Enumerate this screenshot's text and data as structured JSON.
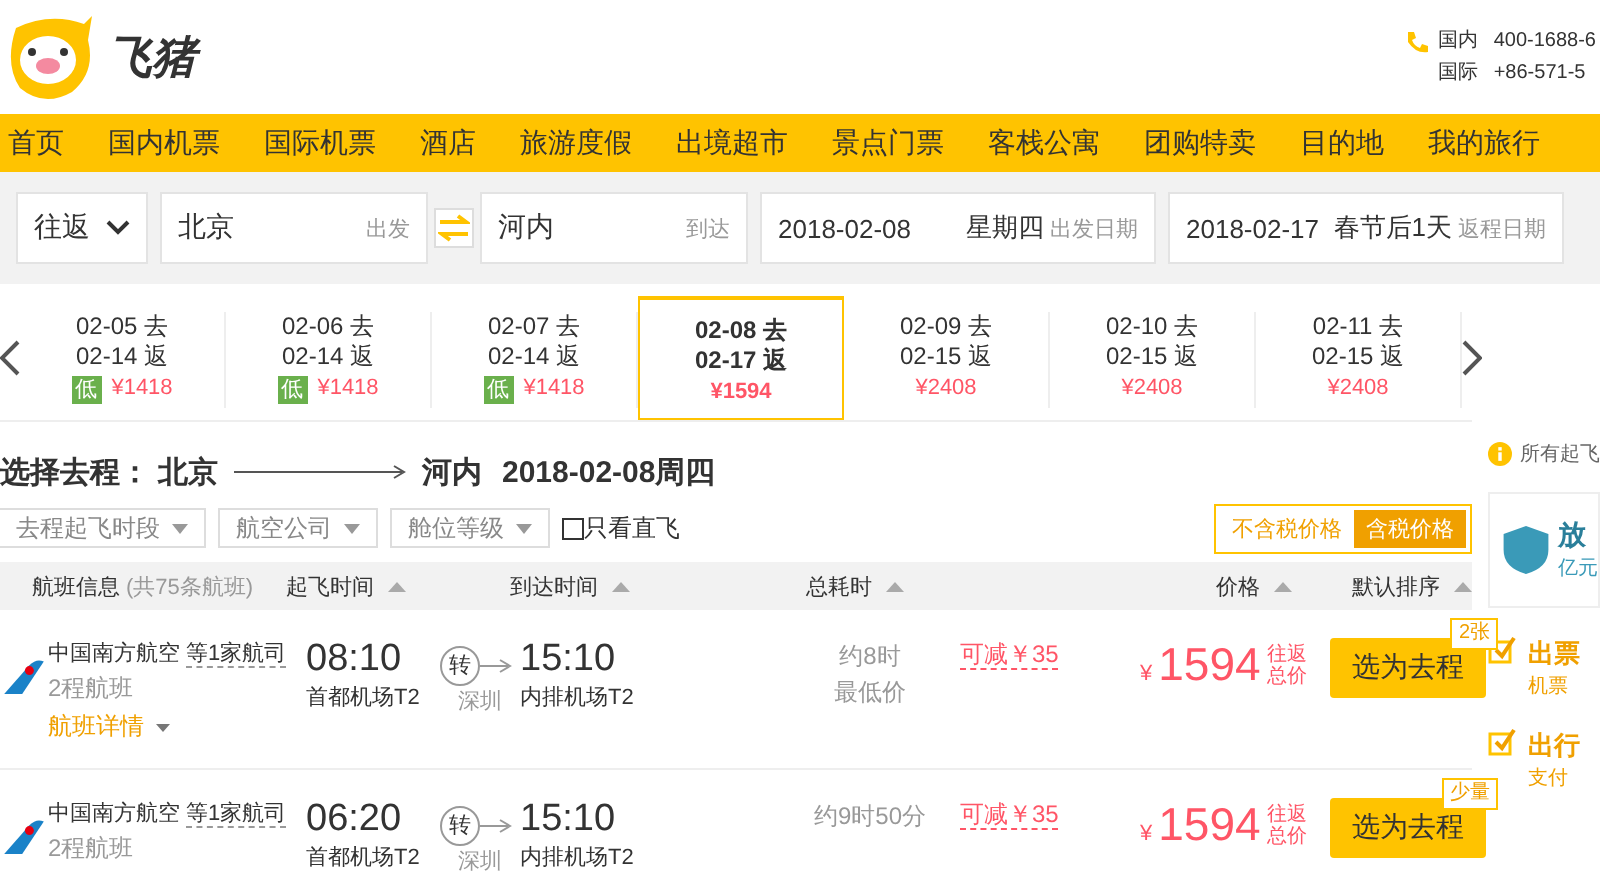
{
  "header": {
    "logo_text": "飞猪",
    "contacts": [
      {
        "label": "国内",
        "number": "400-1688-6"
      },
      {
        "label": "国际",
        "number": "+86-571-5"
      }
    ]
  },
  "nav": [
    "首页",
    "国内机票",
    "国际机票",
    "酒店",
    "旅游度假",
    "出境超市",
    "景点门票",
    "客栈公寓",
    "团购特卖",
    "目的地",
    "我的旅行"
  ],
  "search": {
    "trip_type": "往返",
    "from": {
      "value": "北京",
      "hint": "出发"
    },
    "to": {
      "value": "河内",
      "hint": "到达"
    },
    "depart": {
      "date": "2018-02-08",
      "weekday": "星期四",
      "hint": "出发日期"
    },
    "return": {
      "date": "2018-02-17",
      "weekday": "春节后1天",
      "hint": "返程日期"
    }
  },
  "date_strip": [
    {
      "depart": "02-05 去",
      "return": "02-14 返",
      "badge": "低",
      "price": "¥1418",
      "selected": false
    },
    {
      "depart": "02-06 去",
      "return": "02-14 返",
      "badge": "低",
      "price": "¥1418",
      "selected": false
    },
    {
      "depart": "02-07 去",
      "return": "02-14 返",
      "badge": "低",
      "price": "¥1418",
      "selected": false
    },
    {
      "depart": "02-08 去",
      "return": "02-17 返",
      "price": "¥1594",
      "selected": true
    },
    {
      "depart": "02-09 去",
      "return": "02-15 返",
      "price": "¥2408",
      "selected": false
    },
    {
      "depart": "02-10 去",
      "return": "02-15 返",
      "price": "¥2408",
      "selected": false
    },
    {
      "depart": "02-11 去",
      "return": "02-15 返",
      "price": "¥2408",
      "selected": false
    }
  ],
  "title": {
    "label": "选择去程：",
    "from": "北京",
    "to": "河内",
    "date": "2018-02-08周四"
  },
  "filters": [
    "去程起飞时段",
    "航空公司",
    "舱位等级"
  ],
  "direct_only": {
    "label": "只看直飞",
    "checked": false
  },
  "price_toggle": [
    {
      "label": "不含税价格",
      "selected": false
    },
    {
      "label": "含税价格",
      "selected": true
    }
  ],
  "columns": [
    {
      "label": "航班信息",
      "note": "(共75条航班)",
      "sortable": false
    },
    {
      "label": "起飞时间",
      "sortable": true
    },
    {
      "label": "到达时间",
      "sortable": true
    },
    {
      "label": "总耗时",
      "sortable": true
    },
    {
      "label": "价格",
      "sortable": true
    },
    {
      "label": "默认排序",
      "sortable": true
    }
  ],
  "flights": [
    {
      "airline": "中国南方航空",
      "partners": "等1家航司",
      "legs": "2程航班",
      "details": "航班详情",
      "depart_time": "08:10",
      "depart_airport": "首都机场T2",
      "transfer": "转",
      "via": "深圳",
      "arrive_time": "15:10",
      "arrive_airport": "内排机场T2",
      "duration": "约8时",
      "duration_note": "最低价",
      "discount": "可减￥35",
      "currency": "¥",
      "price": "1594",
      "price_note": "往返总价",
      "button": "选为去程",
      "tag": "2张"
    },
    {
      "airline": "中国南方航空",
      "partners": "等1家航司",
      "legs": "2程航班",
      "depart_time": "06:20",
      "depart_airport": "首都机场T2",
      "transfer": "转",
      "via": "深圳",
      "arrive_time": "15:10",
      "arrive_airport": "内排机场T2",
      "duration": "约9时50分",
      "discount": "可减￥35",
      "currency": "¥",
      "price": "1594",
      "price_note": "往返总价",
      "button": "选为去程",
      "tag": "少量"
    }
  ],
  "side": {
    "notice": "所有起飞",
    "promo": {
      "title": "放",
      "subtitle": "亿元"
    },
    "features": [
      {
        "title": "出票",
        "desc": "机票"
      },
      {
        "title": "出行",
        "desc": "支付"
      }
    ]
  }
}
